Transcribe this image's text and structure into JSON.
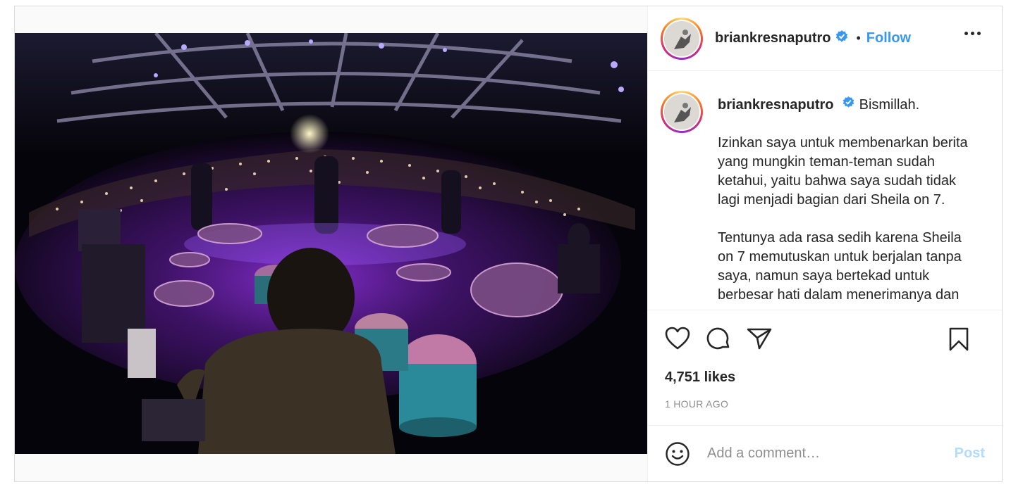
{
  "header": {
    "username": "briankresnaputro",
    "separator": "•",
    "follow_label": "Follow"
  },
  "caption": {
    "username": "briankresnaputro",
    "first_line": "Bismillah.",
    "paragraphs": [
      "Izinkan saya untuk membenarkan berita yang mungkin teman-teman sudah ketahui, yaitu bahwa saya sudah tidak lagi menjadi bagian dari Sheila on 7.",
      "Tentunya ada rasa sedih karena Sheila on 7 memutuskan untuk berjalan tanpa saya, namun saya bertekad untuk berbesar hati dalam menerimanya dan"
    ]
  },
  "stats": {
    "likes": "4,751 likes",
    "time": "1 HOUR AGO"
  },
  "comment": {
    "placeholder": "Add a comment…",
    "post_label": "Post"
  },
  "icons": {
    "verified": "verified-badge-icon",
    "more": "more-horizontal-icon",
    "like": "heart-icon",
    "comment": "comment-bubble-icon",
    "share": "send-icon",
    "save": "bookmark-icon",
    "emoji": "smiley-icon"
  },
  "colors": {
    "accent": "#3897f0",
    "verified": "#3897f0",
    "post_disabled": "#b3dbff"
  }
}
